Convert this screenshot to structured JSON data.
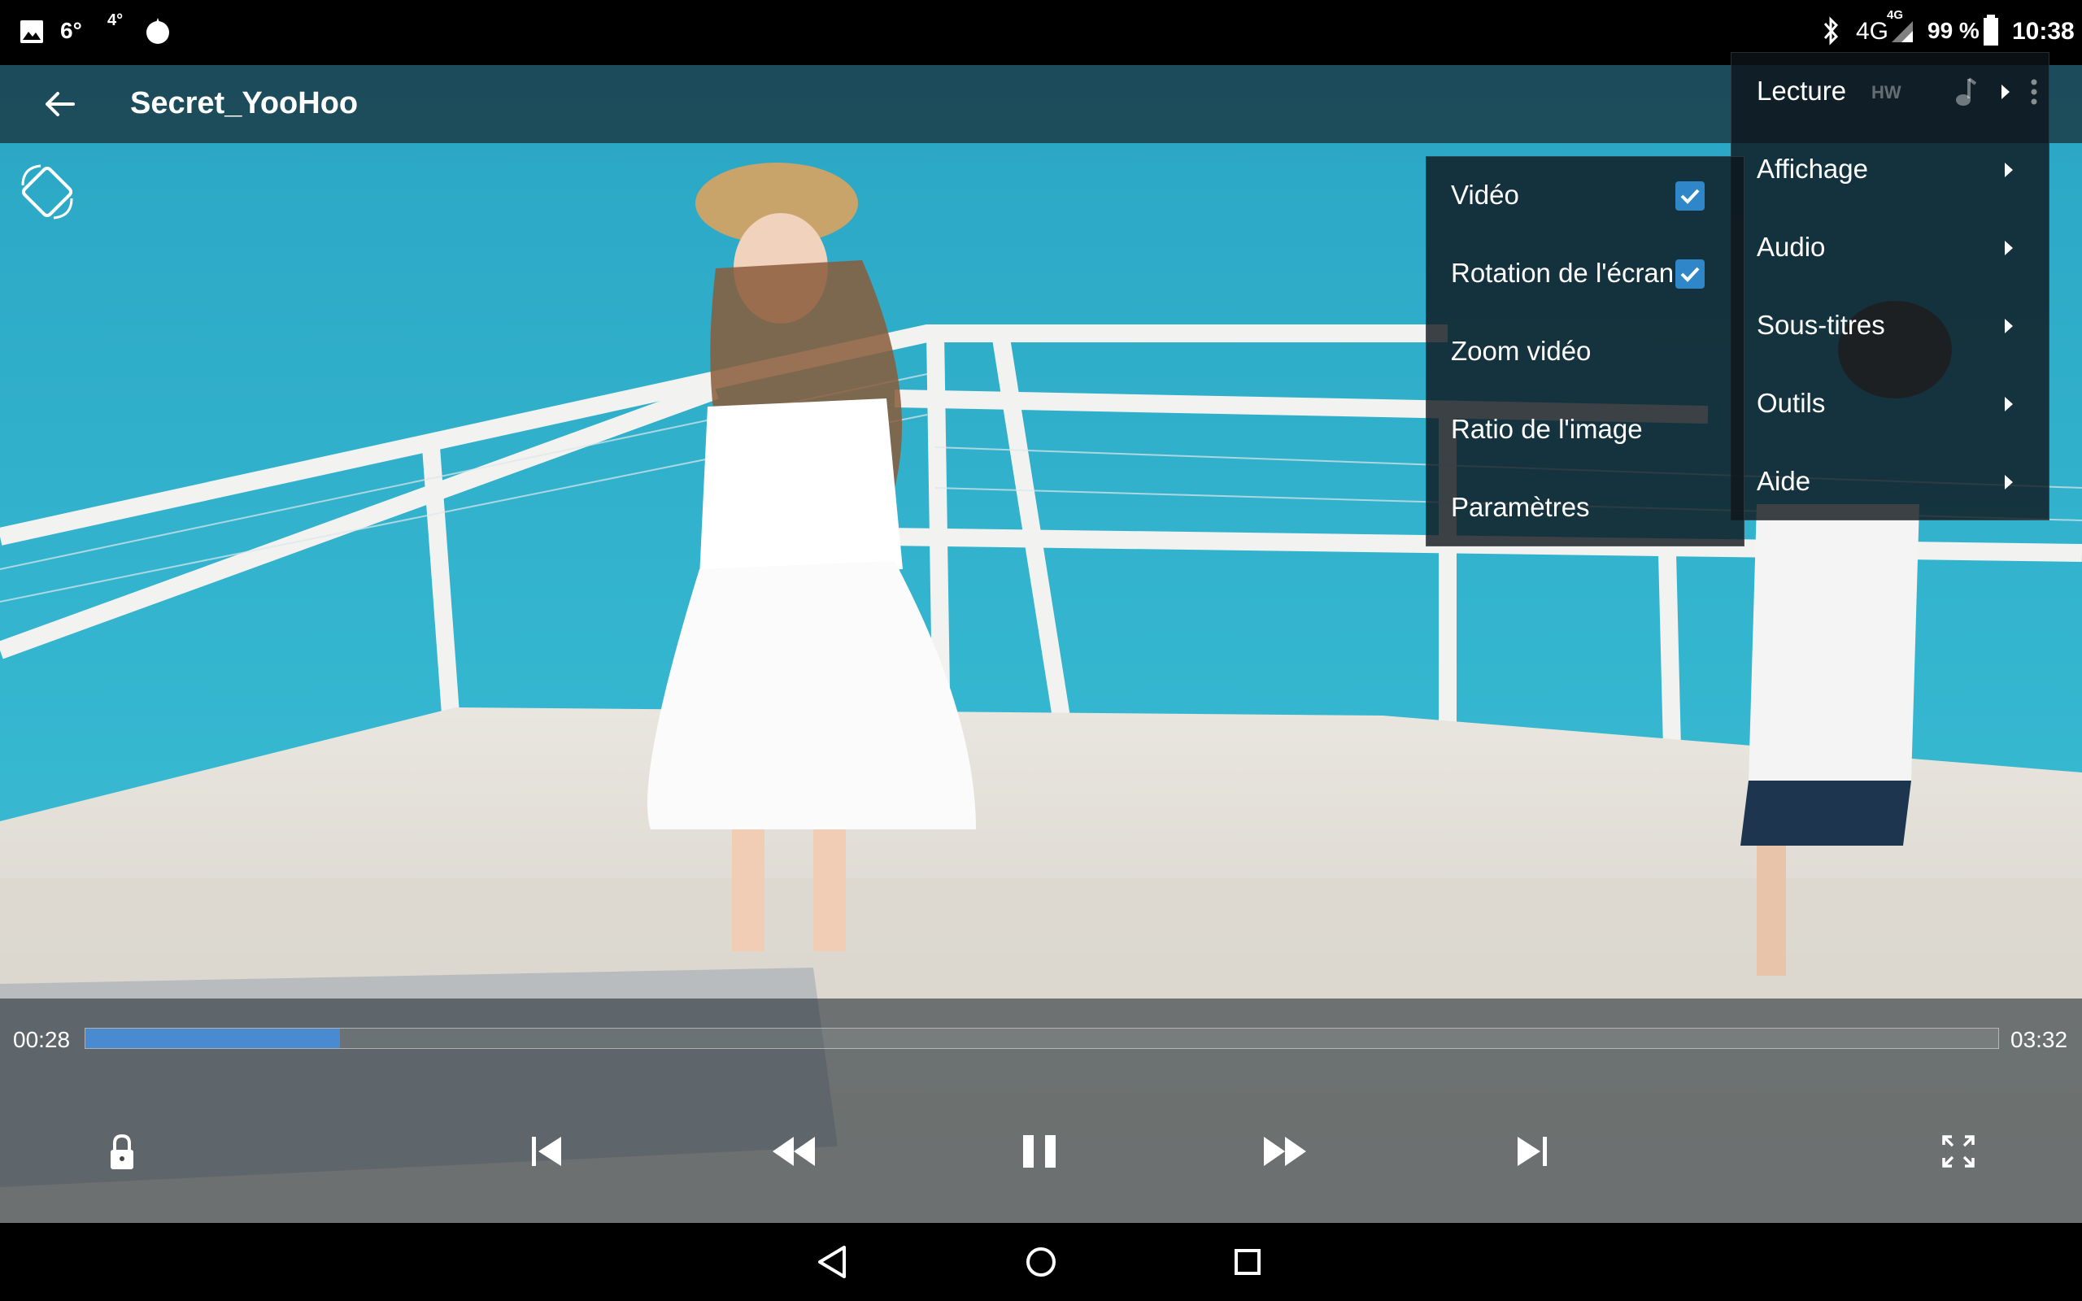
{
  "status_bar": {
    "temp_main": "6°",
    "temp_small": "4°",
    "network": "4G",
    "network_sup": "4G",
    "battery": "99 %",
    "time": "10:38"
  },
  "title_bar": {
    "title": "Secret_YooHoo",
    "icons": {
      "back": "arrow-left-icon",
      "rotate": "screen-rotation-icon"
    }
  },
  "main_menu": {
    "items": [
      {
        "label": "Lecture",
        "badge": "HW",
        "icon": "music-note-icon",
        "has_submenu": true
      },
      {
        "label": "Affichage",
        "has_submenu": true
      },
      {
        "label": "Audio",
        "has_submenu": true
      },
      {
        "label": "Sous-titres",
        "has_submenu": true
      },
      {
        "label": "Outils",
        "has_submenu": true
      },
      {
        "label": "Aide",
        "has_submenu": true
      }
    ]
  },
  "display_submenu": {
    "items": [
      {
        "label": "Vidéo",
        "checked": true
      },
      {
        "label": "Rotation de l'écran",
        "checked": true
      },
      {
        "label": "Zoom vidéo"
      },
      {
        "label": "Ratio de l'image"
      },
      {
        "label": "Paramètres"
      }
    ]
  },
  "player": {
    "time_current": "00:28",
    "time_total": "03:32",
    "progress_fraction": 0.133,
    "controls": [
      "lock-icon",
      "skip-previous-icon",
      "rewind-icon",
      "pause-icon",
      "fast-forward-icon",
      "skip-next-icon",
      "fullscreen-icon"
    ]
  },
  "colors": {
    "accent": "#2f86c8",
    "progress": "#4a8ad0"
  }
}
